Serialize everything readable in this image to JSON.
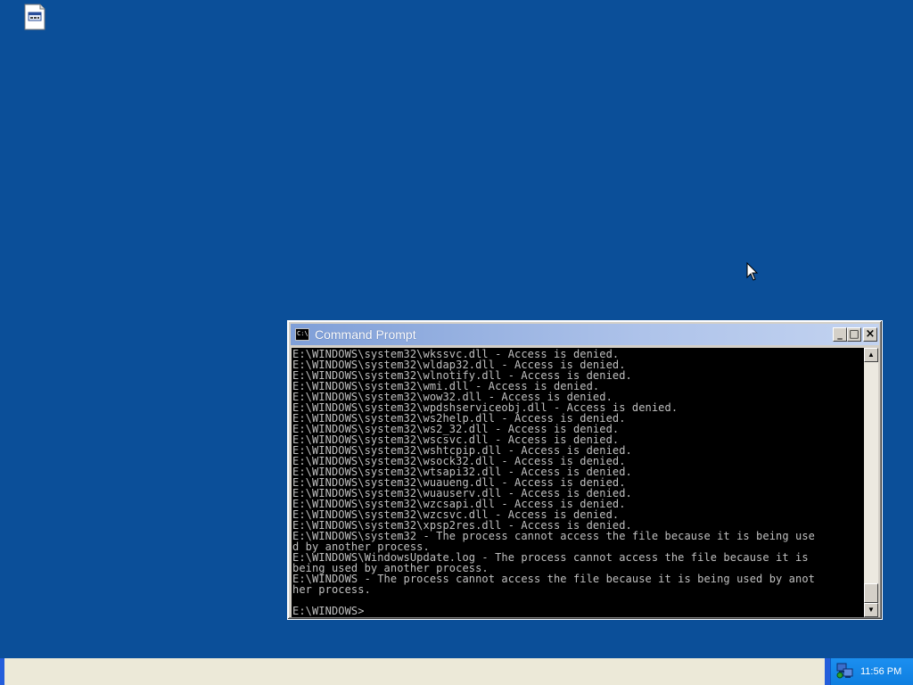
{
  "desktop": {
    "icon_name": "file-icon"
  },
  "window": {
    "title": "Command Prompt",
    "buttons": {
      "minimize": "_",
      "maximize": "□",
      "close": "×"
    },
    "console_lines": [
      "E:\\WINDOWS\\system32\\wkssvc.dll - Access is denied.",
      "E:\\WINDOWS\\system32\\wldap32.dll - Access is denied.",
      "E:\\WINDOWS\\system32\\wlnotify.dll - Access is denied.",
      "E:\\WINDOWS\\system32\\wmi.dll - Access is denied.",
      "E:\\WINDOWS\\system32\\wow32.dll - Access is denied.",
      "E:\\WINDOWS\\system32\\wpdshserviceobj.dll - Access is denied.",
      "E:\\WINDOWS\\system32\\ws2help.dll - Access is denied.",
      "E:\\WINDOWS\\system32\\ws2_32.dll - Access is denied.",
      "E:\\WINDOWS\\system32\\wscsvc.dll - Access is denied.",
      "E:\\WINDOWS\\system32\\wshtcpip.dll - Access is denied.",
      "E:\\WINDOWS\\system32\\wsock32.dll - Access is denied.",
      "E:\\WINDOWS\\system32\\wtsapi32.dll - Access is denied.",
      "E:\\WINDOWS\\system32\\wuaueng.dll - Access is denied.",
      "E:\\WINDOWS\\system32\\wuauserv.dll - Access is denied.",
      "E:\\WINDOWS\\system32\\wzcsapi.dll - Access is denied.",
      "E:\\WINDOWS\\system32\\wzcsvc.dll - Access is denied.",
      "E:\\WINDOWS\\system32\\xpsp2res.dll - Access is denied.",
      "E:\\WINDOWS\\system32 - The process cannot access the file because it is being use",
      "d by another process.",
      "E:\\WINDOWS\\WindowsUpdate.log - The process cannot access the file because it is",
      "being used by another process.",
      "E:\\WINDOWS - The process cannot access the file because it is being used by anot",
      "her process.",
      "",
      "E:\\WINDOWS>"
    ]
  },
  "taskbar": {
    "clock": "11:56 PM",
    "tray_icon_name": "network-icon"
  }
}
